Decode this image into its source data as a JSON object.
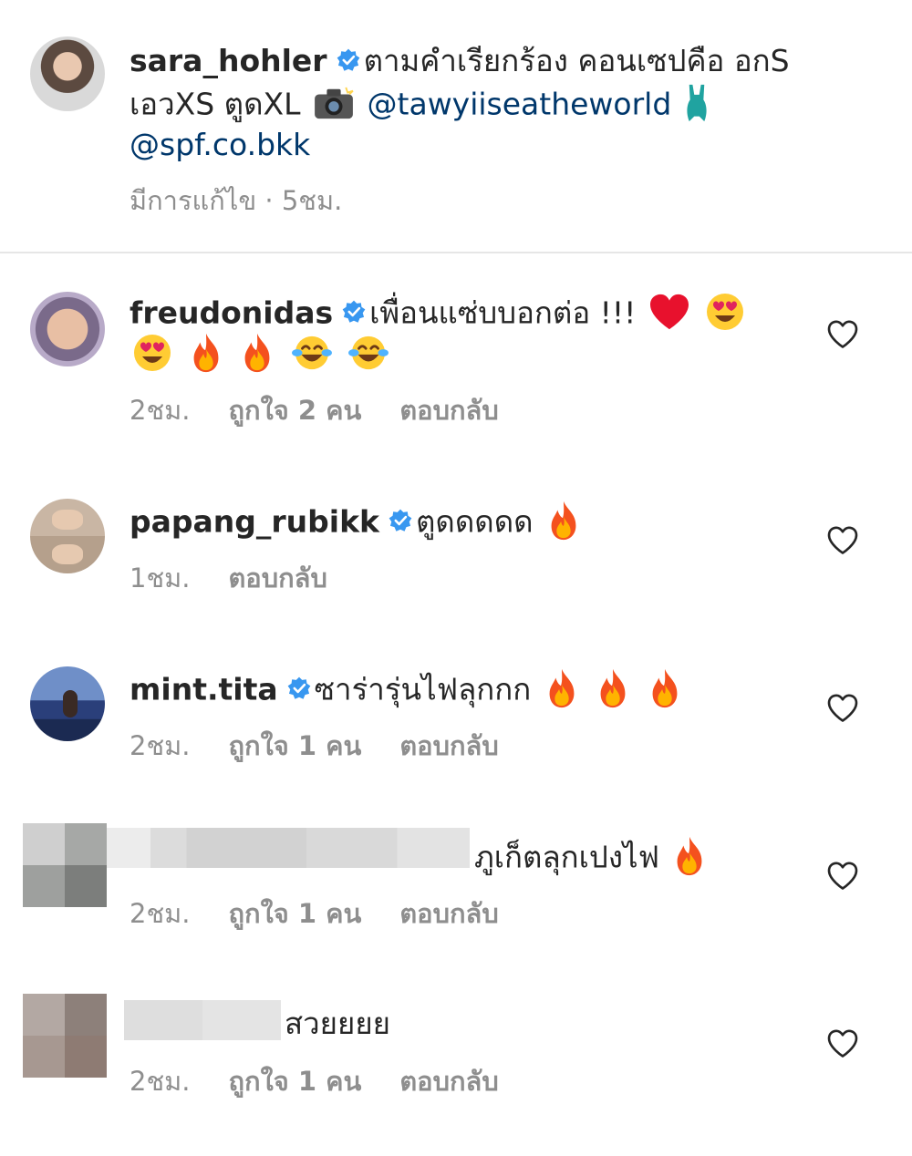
{
  "caption": {
    "username": "sara_hohler",
    "text_line1": "ตามคำเรียกร้อง  คอนเซปคือ อกS",
    "text_line2": "เอวXS ตูดXL",
    "mention1": "@tawyiiseatheworld",
    "mention2": "@spf.co.bkk",
    "meta": "มีการแก้ไข · 5ชม."
  },
  "comments": [
    {
      "username": "freudonidas",
      "text": "เพื่อนแซ่บบอกต่อ !!!",
      "time": "2ชม.",
      "likes": "ถูกใจ 2 คน",
      "reply": "ตอบกลับ"
    },
    {
      "username": "papang_rubikk",
      "text": "ตูดดดดด",
      "time": "1ชม.",
      "reply": "ตอบกลับ"
    },
    {
      "username": "mint.tita",
      "text": "ซาร่ารุ่นไฟลุกกก",
      "time": "2ชม.",
      "likes": "ถูกใจ 1 คน",
      "reply": "ตอบกลับ"
    },
    {
      "text": "ภูเก็ตลุกเปงไฟ",
      "time": "2ชม.",
      "likes": "ถูกใจ 1 คน",
      "reply": "ตอบกลับ"
    },
    {
      "text": "สวยยยย",
      "time": "2ชม.",
      "likes": "ถูกใจ 1 คน",
      "reply": "ตอบกลับ"
    }
  ],
  "icons": {
    "verified": "verified-badge-icon",
    "heart": "heart-outline-icon",
    "fire": "fire-emoji",
    "heart_eyes": "heart-eyes-emoji",
    "red_heart": "red-heart-emoji",
    "joy": "tears-of-joy-emoji",
    "camera": "camera-flash-emoji",
    "swimsuit": "swimsuit-emoji"
  },
  "colors": {
    "text": "#262626",
    "meta": "#8e8e8e",
    "mention": "#00376b",
    "verified": "#3897f0",
    "divider": "#e6e6e6"
  }
}
